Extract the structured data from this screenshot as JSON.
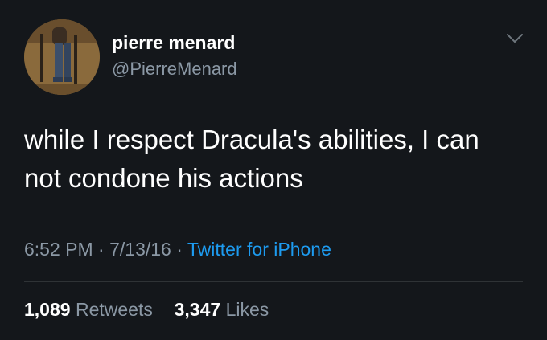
{
  "user": {
    "name": "pierre menard",
    "handle": "@PierreMenard"
  },
  "tweet": {
    "text": "while I respect Dracula's abilities, I can not condone his actions"
  },
  "meta": {
    "time": "6:52 PM",
    "date": "7/13/16",
    "separator": " · ",
    "source": "Twitter for iPhone"
  },
  "stats": {
    "retweets_count": "1,089",
    "retweets_label": "Retweets",
    "likes_count": "3,347",
    "likes_label": "Likes"
  },
  "icons": {
    "more": "chevron-down-icon",
    "avatar": "avatar"
  },
  "colors": {
    "background": "#14171b",
    "text": "#ffffff",
    "secondary": "#8b98a5",
    "link": "#1d9bf0"
  }
}
